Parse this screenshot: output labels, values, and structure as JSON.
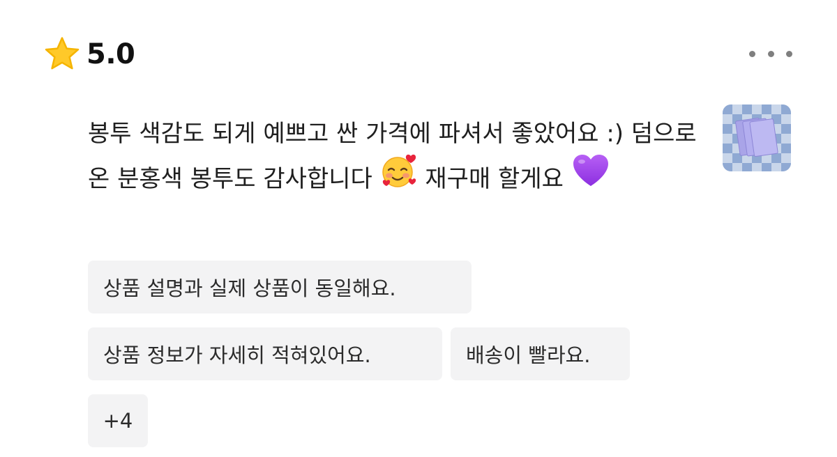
{
  "review": {
    "rating": "5.0",
    "rating_icon": "star-icon",
    "menu_icon": "more-horizontal-icon",
    "text_part1": "봉투 색감도 되게 예쁘고 싼 가격에 파셔서 좋았어요 :) 덤으로 온 분홍색 봉투도 감사합니다 ",
    "emoji1": "🥰",
    "text_part2": " 재구매 할게요 ",
    "emoji2": "💜",
    "thumbnail_icon": "product-photo-thumbnail"
  },
  "tags": [
    "상품 설명과 실제 상품이 동일해요.",
    "상품 정보가 자세히 적혀있어요.",
    "배송이 빨라요."
  ],
  "more_tags": "+4",
  "colors": {
    "star": "#FFC929",
    "tag_background": "#F3F3F4",
    "text": "#1F1F1F",
    "menu_dots": "#7F7F7F"
  }
}
